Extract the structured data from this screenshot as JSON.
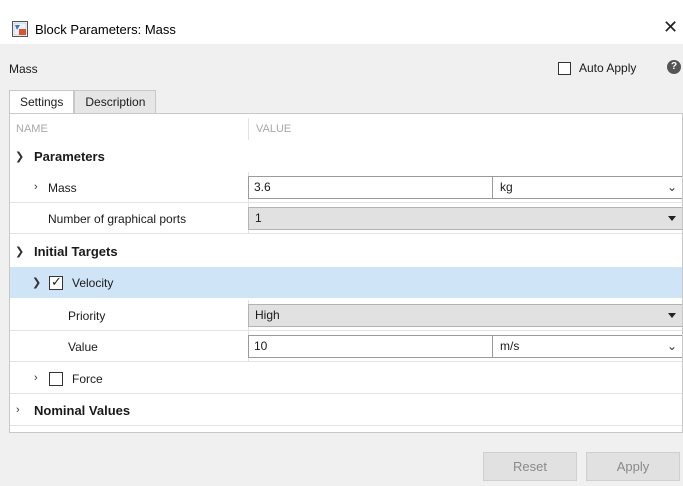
{
  "window": {
    "title": "Block Parameters: Mass",
    "close_glyph": "✕"
  },
  "mask": {
    "title": "Mass",
    "auto_apply_label": "Auto Apply",
    "auto_apply_checked": false,
    "help_glyph": "?"
  },
  "tabs": [
    {
      "label": "Settings",
      "active": true
    },
    {
      "label": "Description",
      "active": false
    }
  ],
  "table": {
    "header_name": "NAME",
    "header_value": "VALUE",
    "sections": {
      "parameters": {
        "label": "Parameters",
        "mass": {
          "label": "Mass",
          "value": "3.6",
          "unit": "kg"
        },
        "ports": {
          "label": "Number of graphical ports",
          "value": "1"
        }
      },
      "initial_targets": {
        "label": "Initial Targets",
        "velocity": {
          "label": "Velocity",
          "checked": true,
          "priority": {
            "label": "Priority",
            "value": "High"
          },
          "value": {
            "label": "Value",
            "value": "10",
            "unit": "m/s"
          }
        },
        "force": {
          "label": "Force",
          "checked": false
        }
      },
      "nominal": {
        "label": "Nominal Values"
      }
    }
  },
  "buttons": {
    "reset": "Reset",
    "apply": "Apply"
  },
  "colors": {
    "selected_row": "#cfe4f7",
    "panel_bg": "#ffffff",
    "dialog_bg": "#f0f0f0"
  },
  "icons": {
    "caret_down": "chevron-down-icon",
    "caret_right": "chevron-right-icon",
    "check": "check-icon",
    "help": "help-icon",
    "app": "simulink-block-icon"
  }
}
